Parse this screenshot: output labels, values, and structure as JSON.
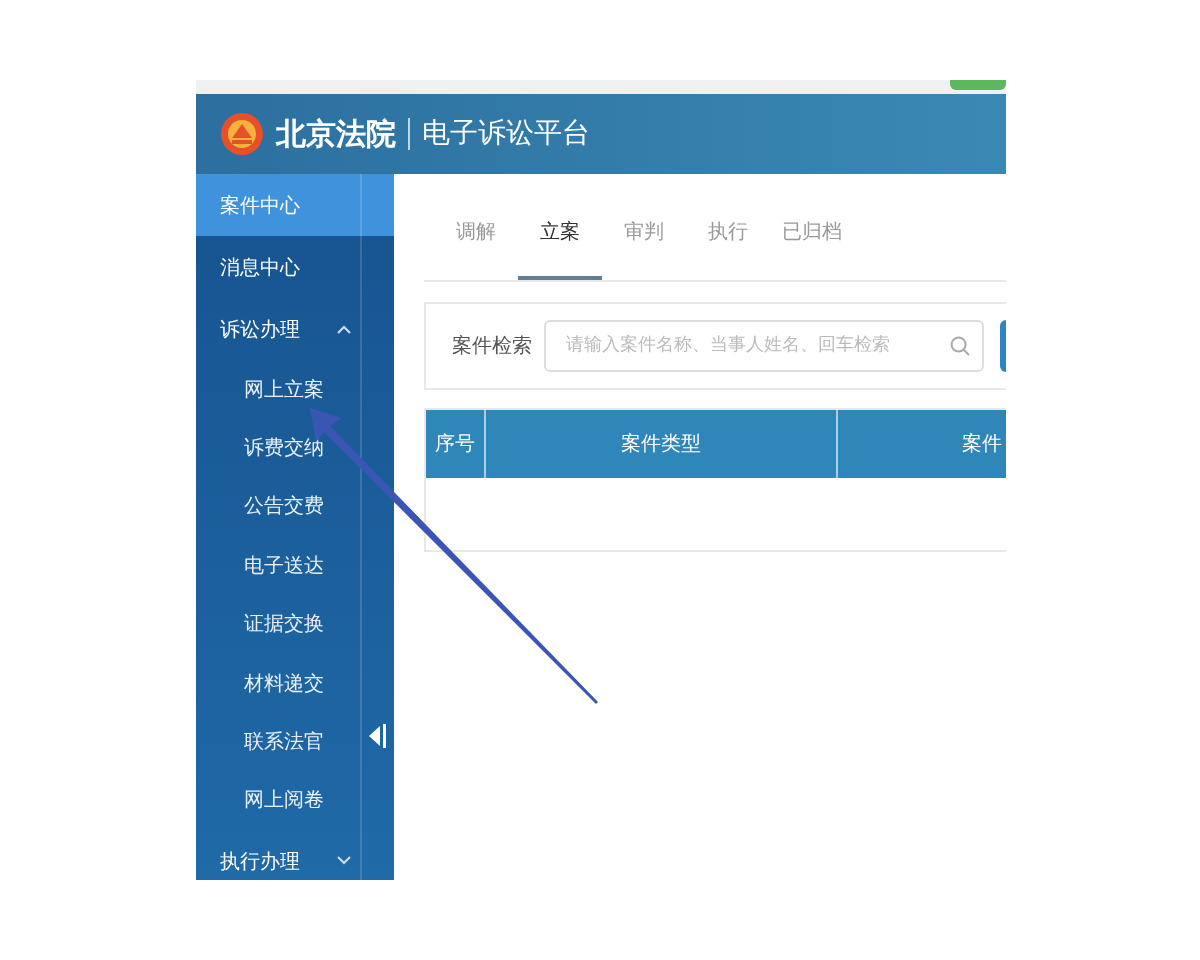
{
  "header": {
    "court_name": "北京法院",
    "platform_name": "电子诉讼平台"
  },
  "sidebar": {
    "items": [
      {
        "kind": "link",
        "label": "案件中心",
        "selected": true
      },
      {
        "kind": "link",
        "label": "消息中心",
        "selected": false
      },
      {
        "kind": "group",
        "label": "诉讼办理",
        "selected": false,
        "expanded": true,
        "children": [
          {
            "label": "网上立案",
            "selected": false
          },
          {
            "label": "诉费交纳",
            "selected": false
          },
          {
            "label": "公告交费",
            "selected": false
          },
          {
            "label": "电子送达",
            "selected": false
          },
          {
            "label": "证据交换",
            "selected": false
          },
          {
            "label": "材料递交",
            "selected": false
          },
          {
            "label": "联系法官",
            "selected": false
          },
          {
            "label": "网上阅卷",
            "selected": false
          }
        ]
      },
      {
        "kind": "group",
        "label": "执行办理",
        "selected": false,
        "expanded": false
      }
    ]
  },
  "tabs": [
    {
      "label": "调解",
      "selected": false
    },
    {
      "label": "立案",
      "selected": true
    },
    {
      "label": "审判",
      "selected": false
    },
    {
      "label": "执行",
      "selected": false
    },
    {
      "label": "已归档",
      "selected": false
    }
  ],
  "search": {
    "label": "案件检索",
    "placeholder": "请输入案件名称、当事人姓名、回车检索"
  },
  "table": {
    "columns": [
      "序号",
      "案件类型",
      "案件"
    ]
  }
}
